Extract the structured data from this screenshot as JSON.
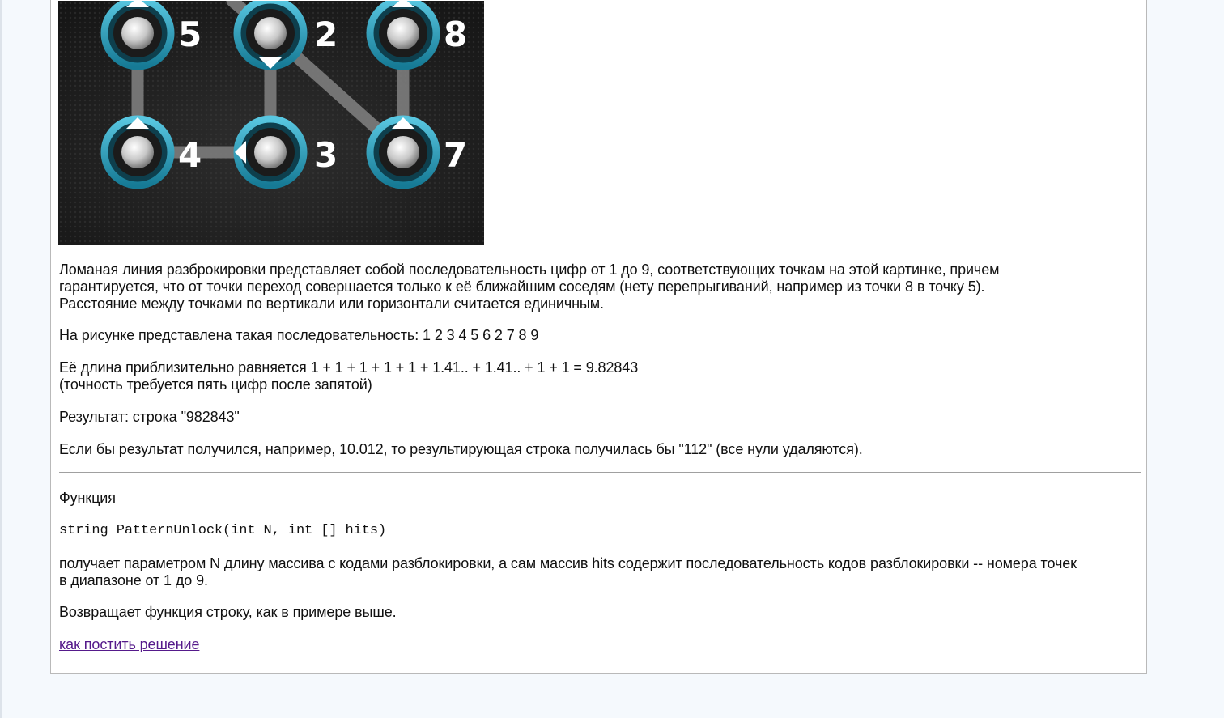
{
  "pattern_image": {
    "alt": "pattern unlock example",
    "dots": [
      {
        "label": "5"
      },
      {
        "label": "2"
      },
      {
        "label": "8"
      },
      {
        "label": "4"
      },
      {
        "label": "3"
      },
      {
        "label": "7"
      }
    ]
  },
  "description": {
    "line1": "Ломаная линия разброкировки представляет собой последовательность цифр от 1 до 9, соответствующих точкам на этой картинке, причем",
    "line2": "гарантируется, что от точки переход совершается только к её ближайшим соседям (нету перепрыгиваний, например из точки 8 в точку 5).",
    "line3": "Расстояние между точками по вертикали или горизонтали считается единичным."
  },
  "sequence_text": "На рисунке представлена такая последовательность: 1 2 3 4 5 6 2 7 8 9",
  "length_text": {
    "line1": "Её длина приблизительно равняется 1 + 1 + 1 + 1 + 1 + 1.41.. + 1.41.. + 1 + 1 = 9.82843",
    "line2": "(точность требуется пять цифр после запятой)"
  },
  "result_text": "Результат: строка \"982843\"",
  "example_text": "Если бы результат получился, например, 10.012, то результирующая строка получилась бы \"112\" (все нули удаляются).",
  "function_heading": "Функция",
  "function_signature": "string PatternUnlock(int N, int [] hits)",
  "params_text": {
    "line1": "получает параметром N длину массива с кодами разблокировки, а сам массив hits содержит последовательность кодов разблокировки -- номера точек",
    "line2": "в диапазоне от 1 до 9."
  },
  "return_text": "Возвращает функция строку, как в примере выше.",
  "solution_link": "как постить решение",
  "colors": {
    "link": "#551a8b",
    "ring": "#2aa6c4",
    "page_background": "#f5f9fd"
  }
}
